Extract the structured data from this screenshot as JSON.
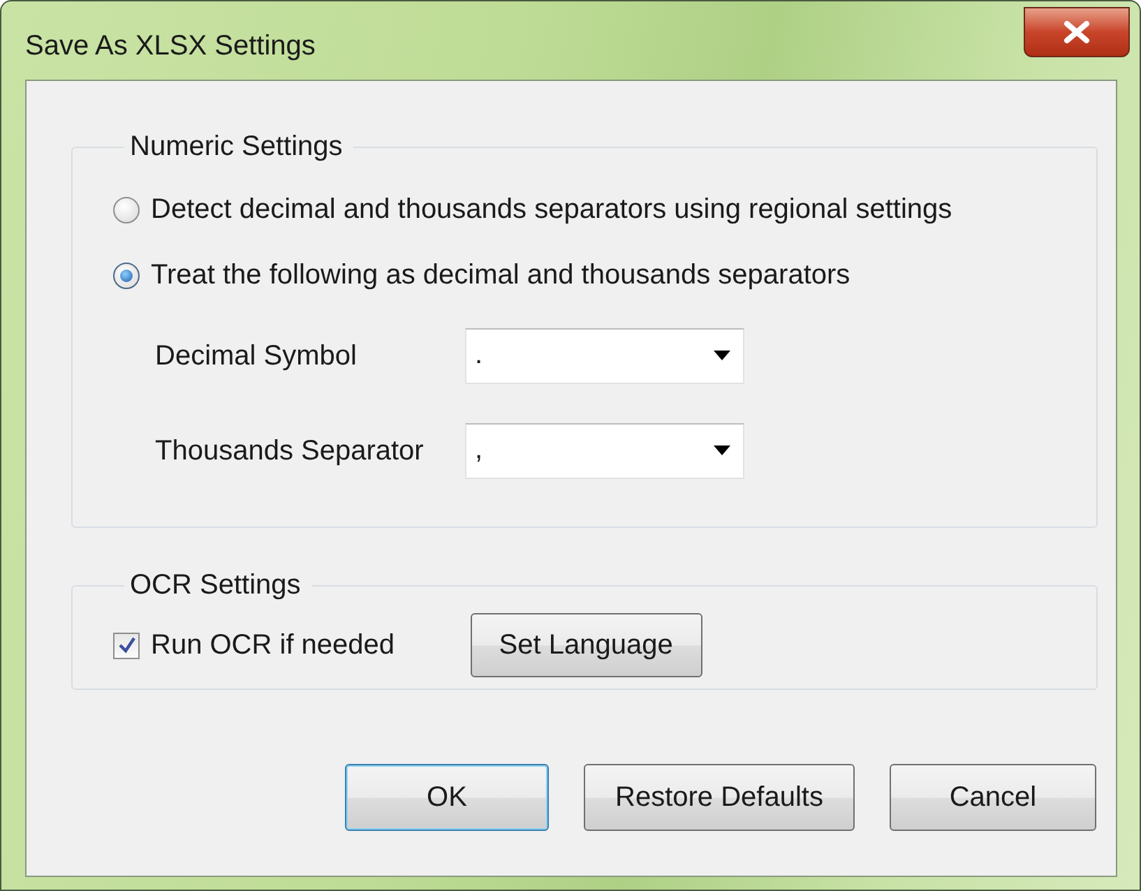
{
  "window": {
    "title": "Save As XLSX Settings"
  },
  "numeric_settings": {
    "title": "Numeric Settings",
    "options": [
      {
        "label": "Detect decimal and thousands separators using regional settings",
        "selected": false
      },
      {
        "label": "Treat the following as decimal and thousands separators",
        "selected": true
      }
    ],
    "fields": [
      {
        "label": "Decimal Symbol",
        "value": "."
      },
      {
        "label": "Thousands Separator",
        "value": ","
      }
    ]
  },
  "ocr_settings": {
    "title": "OCR Settings",
    "checkbox": {
      "label": "Run OCR if needed",
      "checked": true
    },
    "button": "Set Language"
  },
  "buttons": [
    {
      "label": "OK",
      "focused": true
    },
    {
      "label": "Restore Defaults",
      "focused": false
    },
    {
      "label": "Cancel",
      "focused": false
    }
  ]
}
